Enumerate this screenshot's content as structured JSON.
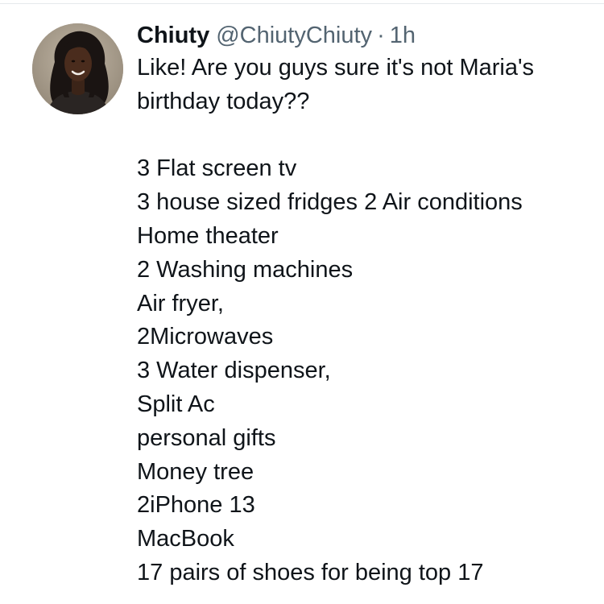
{
  "tweet": {
    "author": {
      "display_name": "Chiuty",
      "handle": "@ChiutyChiuty",
      "separator": "·",
      "timestamp": "1h"
    },
    "intro_lines": [
      "Like! Are you guys sure it's not Maria's",
      "birthday today??"
    ],
    "list_items": [
      "3 Flat screen tv",
      "3 house sized fridges 2 Air conditions",
      "Home theater",
      "2 Washing machines",
      "Air fryer,",
      "2Microwaves",
      "3 Water dispenser,",
      "Split Ac",
      "personal gifts",
      "Money tree",
      "2iPhone 13",
      "MacBook",
      "17 pairs of shoes for being top 17"
    ]
  },
  "colors": {
    "text_primary": "#0f1419",
    "text_secondary": "#536471",
    "divider": "#e6e9ec",
    "background": "#ffffff"
  },
  "icons": {
    "avatar": "profile-photo"
  }
}
